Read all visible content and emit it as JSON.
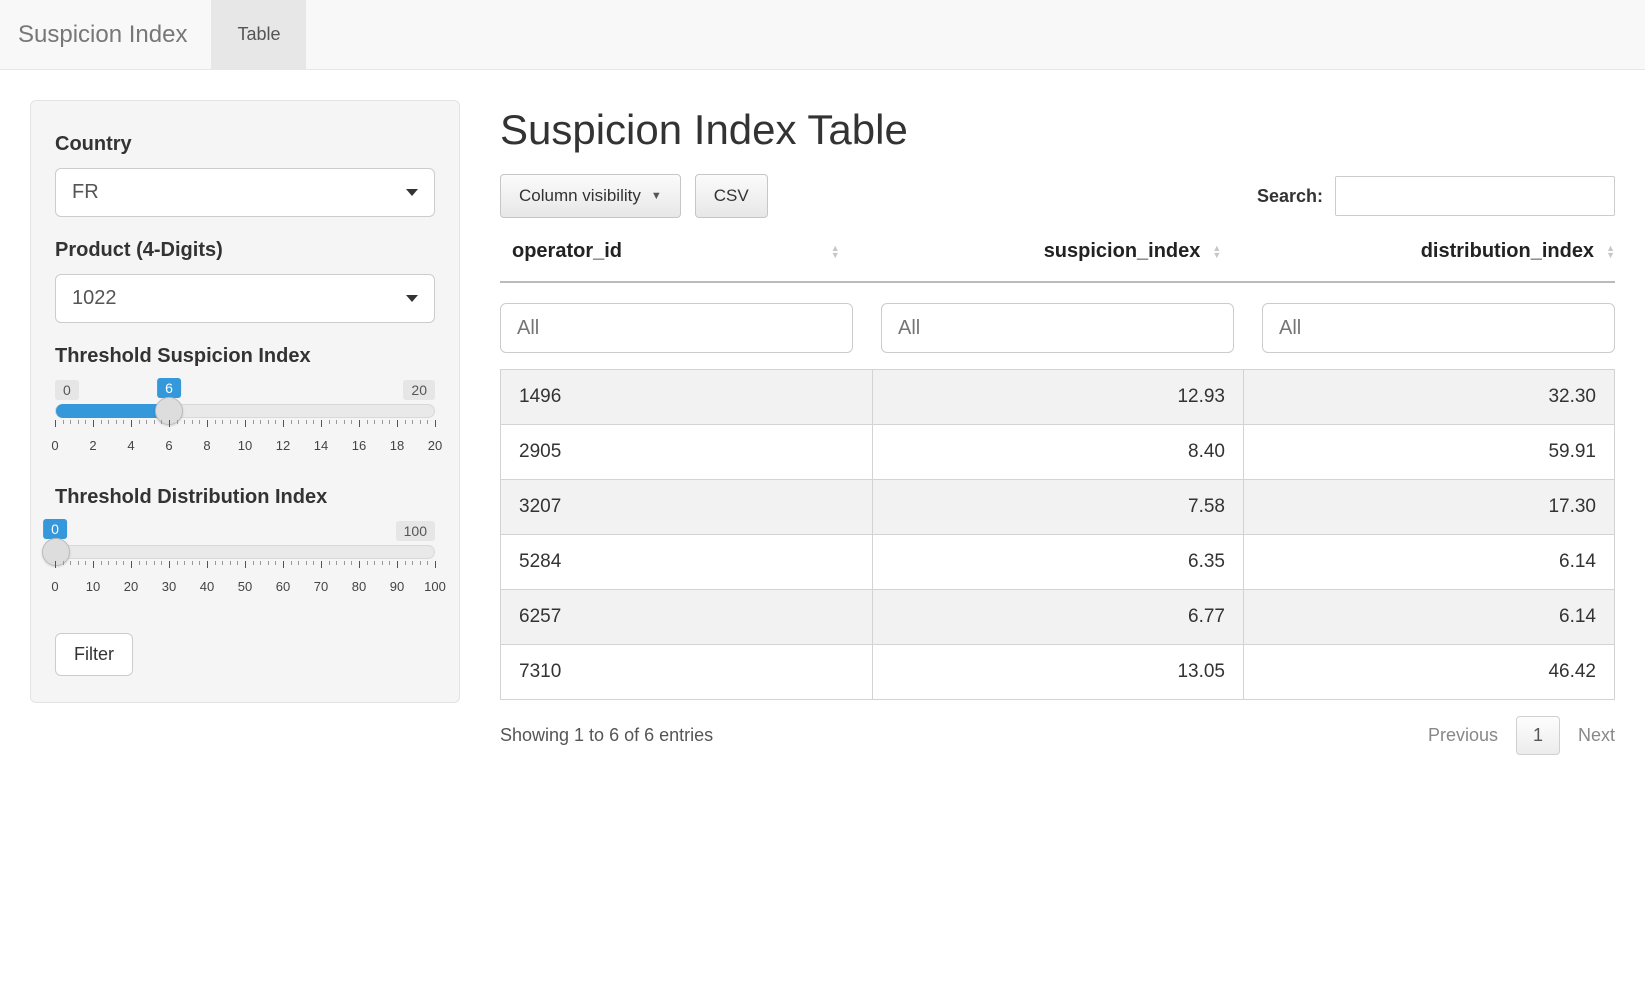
{
  "navbar": {
    "brand": "Suspicion Index",
    "tab": "Table"
  },
  "sidebar": {
    "country_label": "Country",
    "country_value": "FR",
    "product_label": "Product (4-Digits)",
    "product_value": "1022",
    "suspicion_slider": {
      "label": "Threshold Suspicion Index",
      "min": 0,
      "max": 20,
      "value": 6,
      "major_ticks": [
        0,
        2,
        4,
        6,
        8,
        10,
        12,
        14,
        16,
        18,
        20
      ]
    },
    "distribution_slider": {
      "label": "Threshold Distribution Index",
      "min": 0,
      "max": 100,
      "value": 0,
      "major_ticks": [
        0,
        10,
        20,
        30,
        40,
        50,
        60,
        70,
        80,
        90,
        100
      ]
    },
    "filter_button": "Filter"
  },
  "main": {
    "title": "Suspicion Index Table",
    "colvis_button": "Column visibility",
    "csv_button": "CSV",
    "search_label": "Search:",
    "columns": [
      "operator_id",
      "suspicion_index",
      "distribution_index"
    ],
    "filter_placeholder": "All",
    "rows": [
      {
        "operator_id": "1496",
        "suspicion_index": "12.93",
        "distribution_index": "32.30"
      },
      {
        "operator_id": "2905",
        "suspicion_index": "8.40",
        "distribution_index": "59.91"
      },
      {
        "operator_id": "3207",
        "suspicion_index": "7.58",
        "distribution_index": "17.30"
      },
      {
        "operator_id": "5284",
        "suspicion_index": "6.35",
        "distribution_index": "6.14"
      },
      {
        "operator_id": "6257",
        "suspicion_index": "6.77",
        "distribution_index": "6.14"
      },
      {
        "operator_id": "7310",
        "suspicion_index": "13.05",
        "distribution_index": "46.42"
      }
    ],
    "info_text": "Showing 1 to 6 of 6 entries",
    "pager": {
      "prev": "Previous",
      "page": "1",
      "next": "Next"
    }
  }
}
